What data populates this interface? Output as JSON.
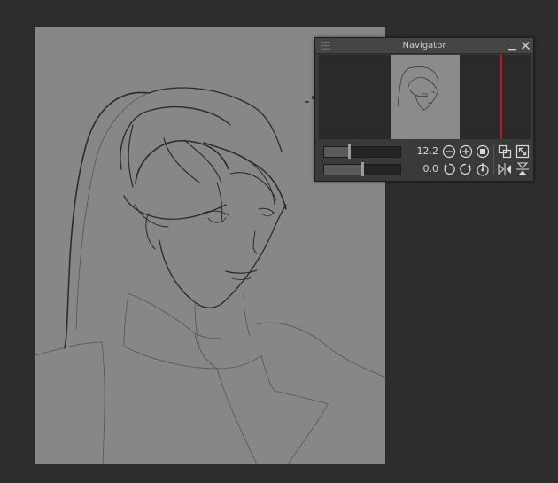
{
  "navigator": {
    "title": "Navigator",
    "zoom_value": "12.2",
    "rotate_value": "0.0",
    "zoom_level": 0.32,
    "rotate_level": 0.5
  },
  "icons": {
    "menu": "hamburger-icon",
    "minimize": "minimize-icon",
    "close": "close-icon",
    "zoom_out": "zoom-out-icon",
    "zoom_in": "zoom-in-icon",
    "stop": "stop-icon",
    "fit": "fit-to-window-icon",
    "actual_size": "expand-icon",
    "rotate_left": "rotate-left-icon",
    "rotate_right": "rotate-right-icon",
    "reset_rotation": "reset-rotation-icon",
    "flip_horizontal": "flip-horizontal-icon",
    "flip_vertical": "flip-vertical-icon"
  },
  "colors": {
    "workspace": "#2d2d2d",
    "canvas": "#878787",
    "panel": "#3a3a3a",
    "view_frame": "#c4161c"
  }
}
